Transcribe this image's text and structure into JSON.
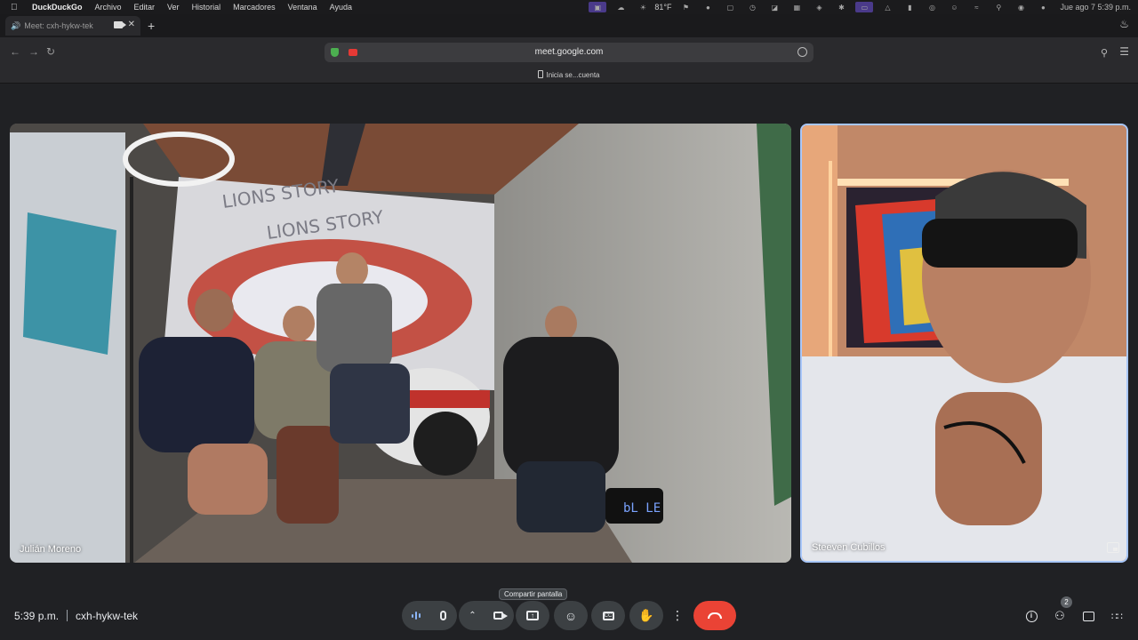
{
  "menubar": {
    "app": "DuckDuckGo",
    "items": [
      "Archivo",
      "Editar",
      "Ver",
      "Historial",
      "Marcadores",
      "Ventana",
      "Ayuda"
    ],
    "temperature": "81°F",
    "datetime": "Jue ago 7  5:39 p.m."
  },
  "tab": {
    "title": "Meet: cxh-hykw-tek"
  },
  "toolbar": {
    "url": "meet.google.com",
    "bookmark": "Inicia se...cuenta"
  },
  "meeting": {
    "time": "5:39 p.m.",
    "code": "cxh-hykw-tek",
    "tooltip": "Compartir pantalla",
    "participants_count": "2"
  },
  "tiles": {
    "main_name": "Julián Moreno",
    "side_name": "Steeven Cubillos"
  },
  "icons": {
    "apple": "apple-icon",
    "speaker": "speaker-icon",
    "camera": "camera-icon",
    "close": "close-icon",
    "plus": "plus-icon",
    "fire": "fire-icon",
    "back": "back-arrow-icon",
    "forward": "forward-arrow-icon",
    "reload": "reload-icon",
    "shield": "shield-icon",
    "key": "key-icon",
    "menu": "hamburger-icon"
  },
  "colors": {
    "end_call": "#ea4335",
    "active_speaker_border": "#a8c7fa",
    "background": "#202124"
  }
}
